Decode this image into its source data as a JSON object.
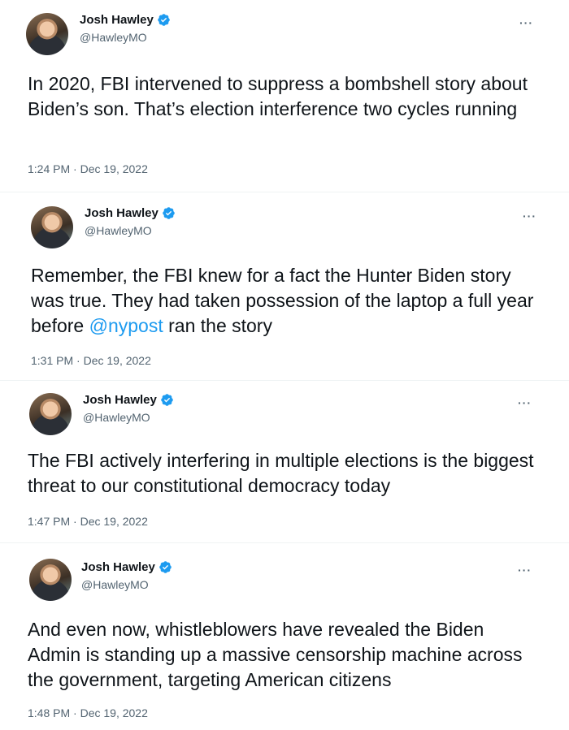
{
  "tweets": [
    {
      "name": "Josh Hawley",
      "handle": "@HawleyMO",
      "text_before": "In 2020, FBI intervened to suppress a bombshell story about Biden’s son. That’s election interference two cycles running",
      "mention": "",
      "text_after": "",
      "time": "1:24 PM · Dec 19, 2022",
      "more_label": "···"
    },
    {
      "name": "Josh Hawley",
      "handle": "@HawleyMO",
      "text_before": "Remember, the FBI knew for a fact the Hunter Biden story was true. They had taken possession of the laptop a full year before ",
      "mention": "@nypost",
      "text_after": " ran the story",
      "time": "1:31 PM · Dec 19, 2022",
      "more_label": "···"
    },
    {
      "name": "Josh Hawley",
      "handle": "@HawleyMO",
      "text_before": "The FBI actively interfering in multiple  elections is the biggest threat to our constitutional democracy today",
      "mention": "",
      "text_after": "",
      "time": "1:47 PM · Dec 19, 2022",
      "more_label": "···"
    },
    {
      "name": "Josh Hawley",
      "handle": "@HawleyMO",
      "text_before": "And even now, whistleblowers have revealed the Biden Admin is standing up a massive censorship machine across the government, targeting American citizens",
      "mention": "",
      "text_after": "",
      "time": "1:48 PM · Dec 19, 2022",
      "more_label": "···"
    }
  ],
  "colors": {
    "text": "#0f1419",
    "secondary": "#536471",
    "link": "#1d9bf0",
    "verified": "#1d9bf0"
  },
  "icons": {
    "verified": "verified-badge-icon",
    "more": "more-horizontal-icon"
  }
}
